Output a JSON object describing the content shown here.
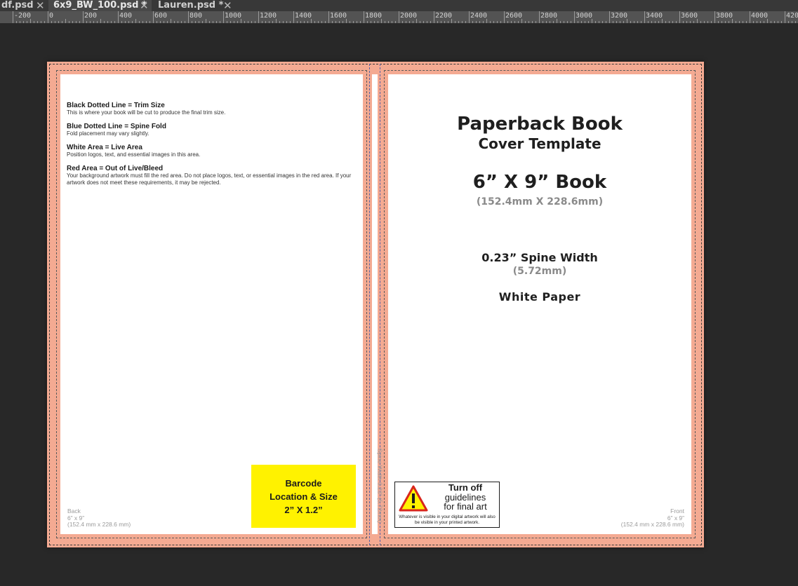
{
  "tabs": [
    {
      "label": "df.psd",
      "active": false
    },
    {
      "label": "6x9_BW_100.psd *",
      "active": true
    },
    {
      "label": "Lauren.psd *",
      "active": false
    }
  ],
  "ruler": {
    "labels": [
      "-200",
      "0",
      "200",
      "400",
      "600",
      "800",
      "1000",
      "1200",
      "1400",
      "1600",
      "1800",
      "2000",
      "2200",
      "2400",
      "2600",
      "2800",
      "3000",
      "3200",
      "3400",
      "3600",
      "3800",
      "4000",
      "420"
    ]
  },
  "back": {
    "info": [
      {
        "title": "Black Dotted Line = Trim Size",
        "desc": "This is where your book will be cut to produce the final trim size."
      },
      {
        "title": "Blue Dotted Line = Spine Fold",
        "desc": "Fold placement may vary slightly."
      },
      {
        "title": "White Area = Live Area",
        "desc": "Position logos, text, and essential images in this area."
      },
      {
        "title": "Red Area = Out of Live/Bleed",
        "desc": "Your background artwork must fill the red area. Do not place logos, text, or essential images in the red area. If your artwork does not meet these requirements, it may be rejected."
      }
    ],
    "corner": {
      "line1": "Back",
      "line2": "6” x 9”",
      "line3": "(152.4 mm x 228.6 mm)"
    },
    "barcode": {
      "line1": "Barcode",
      "line2": "Location & Size",
      "line3": "2” X 1.2”"
    }
  },
  "spine": {
    "label": "Spine Width 0.23\" (5.72mm)"
  },
  "front": {
    "title": "Paperback Book",
    "subtitle": "Cover Template",
    "size": "6” X 9” Book",
    "size_metric": "(152.4mm X 228.6mm)",
    "spine_width": "0.23” Spine Width",
    "spine_metric": "(5.72mm)",
    "paper": "White Paper",
    "corner": {
      "line1": "Front",
      "line2": "6” x 9”",
      "line3": "(152.4 mm x 228.6 mm)"
    },
    "warning": {
      "line1": "Turn off",
      "line2": "guidelines",
      "line3": "for final art",
      "note": "Whatever is visible in your digital artwork will also be visible in your printed artwork."
    }
  },
  "colors": {
    "bleed": "#f4aa92",
    "barcode": "#fff200",
    "canvas": "#282828",
    "spine_guide": "#5560a8"
  }
}
